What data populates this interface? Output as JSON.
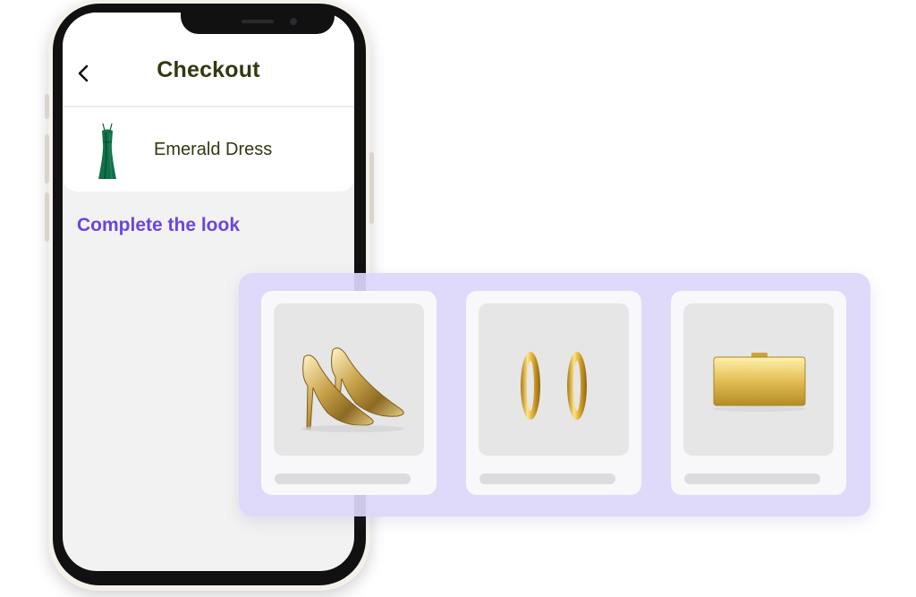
{
  "header": {
    "title": "Checkout",
    "back_icon": "chevron-left-icon"
  },
  "cart": {
    "items": [
      {
        "name": "Emerald Dress",
        "image": "green-dress-image"
      }
    ]
  },
  "recommendations": {
    "title": "Complete the look",
    "items": [
      {
        "image": "gold-pumps-image"
      },
      {
        "image": "gold-hoop-earrings-image"
      },
      {
        "image": "gold-clutch-image"
      }
    ]
  },
  "colors": {
    "title_text": "#2f3a10",
    "accent": "#6a46db",
    "panel_bg": "#dcd6fa"
  }
}
